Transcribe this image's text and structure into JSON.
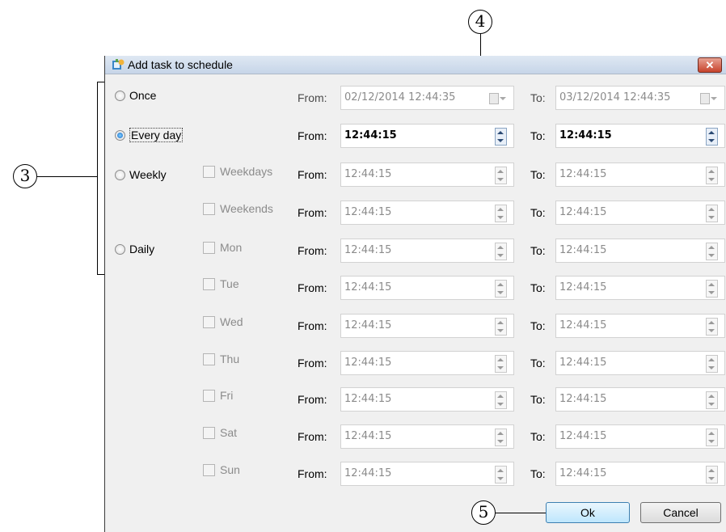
{
  "window": {
    "title": "Add task to schedule",
    "close_label": "✕"
  },
  "modes": [
    {
      "key": "once",
      "label": "Once",
      "checked": false
    },
    {
      "key": "every_day",
      "label": "Every day",
      "checked": true
    },
    {
      "key": "weekly",
      "label": "Weekly",
      "checked": false
    },
    {
      "key": "daily",
      "label": "Daily",
      "checked": false
    }
  ],
  "from_label": "From:",
  "to_label": "To:",
  "rows": [
    {
      "check": "",
      "from": "02/12/2014 12:44:35",
      "to": "03/12/2014 12:44:35"
    },
    {
      "check": "",
      "from": "12:44:15",
      "to": "12:44:15"
    },
    {
      "check": "Weekdays",
      "from": "12:44:15",
      "to": "12:44:15"
    },
    {
      "check": "Weekends",
      "from": "12:44:15",
      "to": "12:44:15"
    },
    {
      "check": "Mon",
      "from": "12:44:15",
      "to": "12:44:15"
    },
    {
      "check": "Tue",
      "from": "12:44:15",
      "to": "12:44:15"
    },
    {
      "check": "Wed",
      "from": "12:44:15",
      "to": "12:44:15"
    },
    {
      "check": "Thu",
      "from": "12:44:15",
      "to": "12:44:15"
    },
    {
      "check": "Fri",
      "from": "12:44:15",
      "to": "12:44:15"
    },
    {
      "check": "Sat",
      "from": "12:44:15",
      "to": "12:44:15"
    },
    {
      "check": "Sun",
      "from": "12:44:15",
      "to": "12:44:15"
    }
  ],
  "buttons": {
    "ok": "Ok",
    "cancel": "Cancel"
  },
  "callouts": {
    "c3": "3",
    "c4": "4",
    "c5": "5"
  },
  "colors": {
    "titlebar": "#c6d5e8",
    "close": "#c7432c",
    "ok_border": "#3c7fb1"
  }
}
